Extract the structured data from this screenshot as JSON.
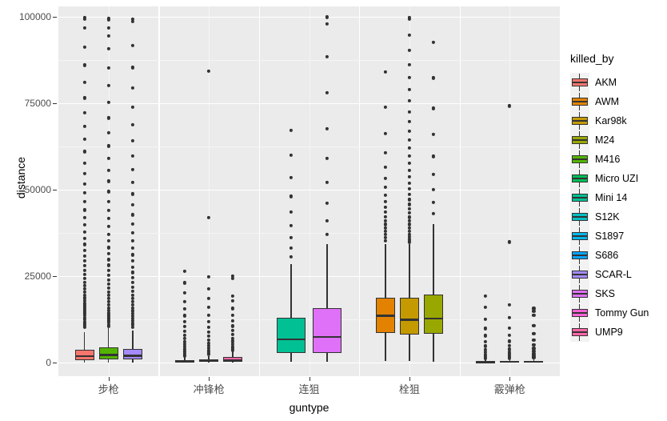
{
  "chart_data": {
    "type": "box",
    "title": "",
    "xlabel": "guntype",
    "ylabel": "distance",
    "ylim": [
      -4000,
      103000
    ],
    "yticks": [
      0,
      25000,
      50000,
      75000,
      100000
    ],
    "ytick_labels": [
      "0",
      "25000",
      "50000",
      "75000",
      "100000"
    ],
    "grid": true,
    "legend_position": "right",
    "legend_title": "killed_by",
    "categories": [
      "步枪",
      "冲锋枪",
      "连狙",
      "栓狙",
      "霰弹枪"
    ],
    "fill_colors": {
      "AKM": "#F8766D",
      "AWM": "#E28200",
      "Kar98k": "#C49A00",
      "M24": "#99A800",
      "M416": "#53B400",
      "Micro UZI": "#00BC56",
      "Mini 14": "#00C094",
      "S12K": "#00BFC4",
      "S1897": "#00B6EB",
      "S686": "#06A4FF",
      "SCAR-L": "#A58AFF",
      "SKS": "#DF70F8",
      "Tommy Gun": "#FB61D7",
      "UMP9": "#FF66A8"
    },
    "legend_entries": [
      "AKM",
      "AWM",
      "Kar98k",
      "M24",
      "M416",
      "Micro UZI",
      "Mini 14",
      "S12K",
      "S1897",
      "S686",
      "SCAR-L",
      "SKS",
      "Tommy Gun",
      "UMP9"
    ],
    "groups": [
      {
        "category": "步枪",
        "boxes": [
          {
            "name": "AKM",
            "q1": 700,
            "median": 1750,
            "q3": 3600,
            "whisker_low": 0,
            "whisker_high": 8700,
            "outliers": [
              10100,
              10600,
              11200,
              11800,
              12400,
              13000,
              13600,
              14200,
              14900,
              15600,
              16300,
              17000,
              17800,
              18600,
              19400,
              20300,
              21200,
              22100,
              23100,
              24200,
              25400,
              26600,
              27900,
              29300,
              30800,
              32400,
              34100,
              35900,
              37800,
              39800,
              41900,
              44100,
              46500,
              49000,
              51700,
              54600,
              57700,
              61000,
              64500,
              68200,
              72200,
              76500,
              81100,
              86000,
              91200,
              96700,
              99300,
              99800
            ]
          },
          {
            "name": "M416",
            "q1": 800,
            "median": 2100,
            "q3": 4300,
            "whisker_low": 0,
            "whisker_high": 9800,
            "outliers": [
              10300,
              10900,
              11500,
              12100,
              12800,
              13500,
              14200,
              15000,
              15800,
              16600,
              17500,
              18400,
              19400,
              20400,
              21500,
              22700,
              23900,
              25200,
              26600,
              28100,
              29700,
              31400,
              33200,
              35100,
              37100,
              39300,
              41600,
              44000,
              46600,
              49400,
              52400,
              55600,
              59000,
              62600,
              66500,
              70700,
              75200,
              80000,
              85200,
              90800,
              94400,
              96800,
              99000,
              99600
            ]
          },
          {
            "name": "SCAR-L",
            "q1": 750,
            "median": 1900,
            "q3": 3900,
            "whisker_low": 0,
            "whisker_high": 9200,
            "outliers": [
              10200,
              10800,
              11400,
              12000,
              12700,
              13400,
              14100,
              14900,
              15700,
              16600,
              17500,
              18500,
              19500,
              20600,
              21800,
              23100,
              24500,
              26000,
              27600,
              29300,
              31100,
              33100,
              35200,
              37500,
              40000,
              42700,
              45600,
              48700,
              52100,
              55800,
              59800,
              64100,
              68800,
              73900,
              79400,
              85300,
              91700,
              98600,
              99400
            ]
          }
        ]
      },
      {
        "category": "冲锋枪",
        "boxes": [
          {
            "name": "Micro UZI",
            "q1": 100,
            "median": 300,
            "q3": 700,
            "whisker_low": 0,
            "whisker_high": 1500,
            "outliers": [
              1800,
              2100,
              2500,
              2900,
              3400,
              3900,
              4500,
              5200,
              6000,
              6900,
              7900,
              9000,
              10300,
              11800,
              13500,
              15400,
              17600,
              20100,
              23000,
              26300
            ]
          },
          {
            "name": "Tommy Gun",
            "q1": 150,
            "median": 400,
            "q3": 900,
            "whisker_low": 0,
            "whisker_high": 1900,
            "outliers": [
              2200,
              2600,
              3000,
              3500,
              4100,
              4800,
              5600,
              6500,
              7600,
              8800,
              10200,
              11800,
              13700,
              15900,
              18400,
              21300,
              24700,
              41800,
              84200
            ]
          },
          {
            "name": "UMP9",
            "q1": 250,
            "median": 700,
            "q3": 1500,
            "whisker_low": 0,
            "whisker_high": 3100,
            "outliers": [
              3500,
              4000,
              4600,
              5300,
              6100,
              7000,
              8000,
              9200,
              10500,
              12000,
              13700,
              15600,
              17800,
              19200,
              24300,
              24900
            ]
          }
        ]
      },
      {
        "category": "连狙",
        "boxes": [
          {
            "name": "Mini 14",
            "q1": 2700,
            "median": 6600,
            "q3": 13000,
            "whisker_low": 100,
            "whisker_high": 28500,
            "outliers": [
              30500,
              33000,
              36000,
              39500,
              43500,
              48000,
              53500,
              60000,
              67200
            ]
          },
          {
            "name": "SKS",
            "q1": 2800,
            "median": 7400,
            "q3": 15600,
            "whisker_low": 100,
            "whisker_high": 34200,
            "outliers": [
              37000,
              41000,
              46000,
              52000,
              59000,
              67500,
              78000,
              88500,
              97900,
              99900
            ]
          }
        ]
      },
      {
        "category": "栓狙",
        "boxes": [
          {
            "name": "AWM",
            "q1": 8500,
            "median": 13500,
            "q3": 18800,
            "whisker_low": 400,
            "whisker_high": 34200,
            "outliers": [
              35200,
              36100,
              37000,
              37900,
              38900,
              39900,
              41000,
              42200,
              43500,
              44900,
              46500,
              48400,
              50600,
              53200,
              56400,
              60600,
              66200,
              73800,
              84000
            ]
          },
          {
            "name": "Kar98k",
            "q1": 8100,
            "median": 12300,
            "q3": 18700,
            "whisker_low": 300,
            "whisker_high": 34100,
            "outliers": [
              34800,
              35500,
              36300,
              37100,
              38000,
              38900,
              39900,
              40900,
              42000,
              43200,
              44400,
              45700,
              47100,
              48600,
              50200,
              51900,
              53700,
              55600,
              57600,
              59700,
              62000,
              64400,
              66900,
              69600,
              72500,
              75600,
              78900,
              82400,
              86200,
              90300,
              94700,
              99400,
              99800
            ]
          },
          {
            "name": "M24",
            "q1": 8200,
            "median": 12700,
            "q3": 19600,
            "whisker_low": 200,
            "whisker_high": 40000,
            "outliers": [
              43000,
              46200,
              50000,
              54300,
              59600,
              66000,
              73500,
              82300,
              92600
            ]
          }
        ]
      },
      {
        "category": "霰弹枪",
        "boxes": [
          {
            "name": "S12K",
            "q1": 50,
            "median": 150,
            "q3": 400,
            "whisker_low": 0,
            "whisker_high": 900,
            "outliers": [
              1100,
              1400,
              1800,
              2300,
              2900,
              3700,
              4700,
              6000,
              7700,
              9800,
              12500,
              16000,
              19200
            ]
          },
          {
            "name": "S1897",
            "q1": 60,
            "median": 180,
            "q3": 450,
            "whisker_low": 0,
            "whisker_high": 1000,
            "outliers": [
              1200,
              1500,
              1900,
              2400,
              3000,
              3800,
              4800,
              6100,
              7800,
              10000,
              12900,
              16600,
              34800,
              74200
            ]
          },
          {
            "name": "S686",
            "q1": 70,
            "median": 200,
            "q3": 500,
            "whisker_low": 0,
            "whisker_high": 1100,
            "outliers": [
              1300,
              1600,
              2000,
              2500,
              3200,
              4000,
              5100,
              6500,
              8300,
              10600,
              13600,
              14800,
              15600
            ]
          }
        ]
      }
    ]
  }
}
